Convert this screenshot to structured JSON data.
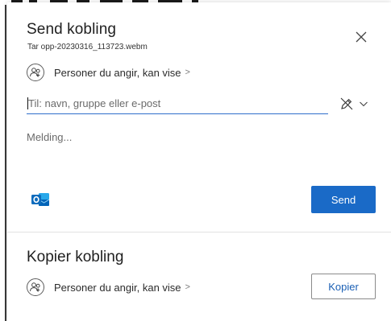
{
  "dialog": {
    "send_section": {
      "title": "Send kobling",
      "filename": "Tar opp-20230316_113723.webm",
      "permission_label": "Personer du angir, kan vise",
      "permission_chevron": ">",
      "to_placeholder": "Til: navn, gruppe eller e-post",
      "message_placeholder": "Melding...",
      "send_label": "Send"
    },
    "copy_section": {
      "title": "Kopier kobling",
      "permission_label": "Personer du angir, kan vise",
      "permission_chevron": ">",
      "copy_label": "Kopier"
    }
  },
  "icons": {
    "close": "close-icon",
    "people": "people-icon",
    "edit_permissions": "pen-slash-icon",
    "dropdown": "chevron-down-icon",
    "outlook": "outlook-icon"
  },
  "colors": {
    "primary_button": "#1a6ac7",
    "input_underline": "#2f6fcb",
    "outlook_blue": "#0f6cbd",
    "copy_text": "#1a5fb4"
  }
}
